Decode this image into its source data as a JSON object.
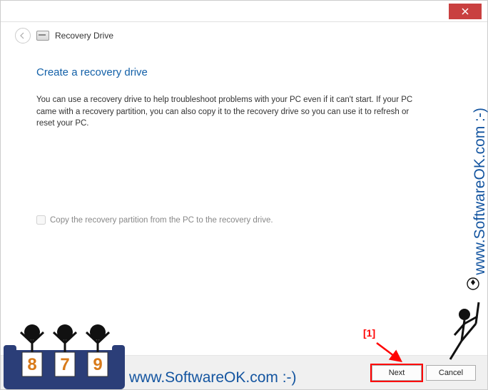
{
  "titlebar": {
    "close_icon": "close"
  },
  "header": {
    "breadcrumb": "Recovery Drive"
  },
  "content": {
    "heading": "Create a recovery drive",
    "body": "You can use a recovery drive to help troubleshoot problems with your PC even if it can't start. If your PC came with a recovery partition, you can also copy it to the recovery drive so you can use it to refresh or reset your PC.",
    "checkbox_label": "Copy the recovery partition from the PC to the recovery drive."
  },
  "buttons": {
    "next": "Next",
    "cancel": "Cancel"
  },
  "annotations": {
    "label1": "[1]"
  },
  "watermark": {
    "text": "www.SoftwareOK.com :-)"
  },
  "judges": {
    "score1": "8",
    "score2": "7",
    "score3": "9"
  }
}
